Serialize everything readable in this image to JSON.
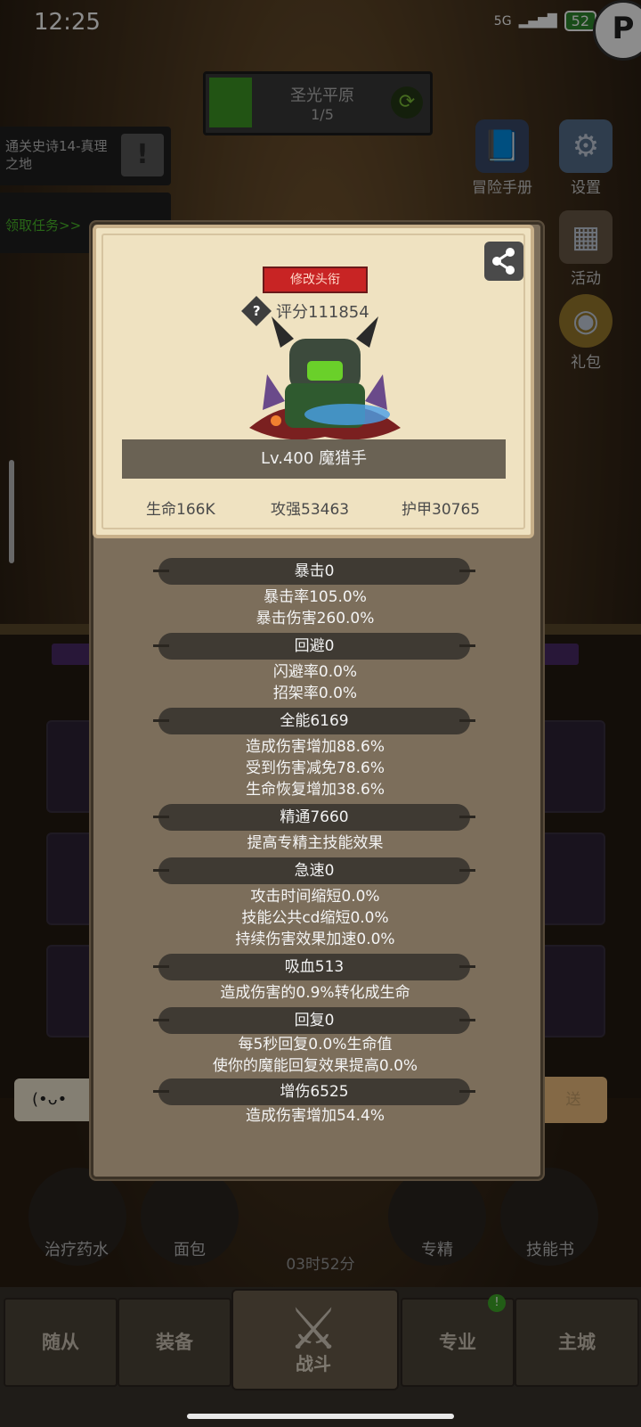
{
  "status_bar": {
    "time": "12:25",
    "network": "5G",
    "battery": "52"
  },
  "map": {
    "name": "圣光平原",
    "progress": "1/5"
  },
  "quests": {
    "epic": "通关史诗14-真理之地",
    "claim": "领取任务>>"
  },
  "side_menu": [
    {
      "label": "冒险手册"
    },
    {
      "label": "设置"
    },
    {
      "label": "活动"
    },
    {
      "label": "礼包"
    }
  ],
  "profile": {
    "change_title_label": "修改头衔",
    "score": "评分111854",
    "level_name": "Lv.400 魔猎手",
    "base_stats": {
      "hp": "生命166K",
      "attack": "攻强53463",
      "armor": "护甲30765"
    }
  },
  "stat_sections": [
    {
      "title": "暴击0",
      "lines": [
        "暴击率105.0%",
        "暴击伤害260.0%"
      ]
    },
    {
      "title": "回避0",
      "lines": [
        "闪避率0.0%",
        "招架率0.0%"
      ]
    },
    {
      "title": "全能6169",
      "lines": [
        "造成伤害增加88.6%",
        "受到伤害减免78.6%",
        "生命恢复增加38.6%"
      ]
    },
    {
      "title": "精通7660",
      "lines": [
        "提高专精主技能效果"
      ]
    },
    {
      "title": "急速0",
      "lines": [
        "攻击时间缩短0.0%",
        "技能公共cd缩短0.0%",
        "持续伤害效果加速0.0%"
      ]
    },
    {
      "title": "吸血513",
      "lines": [
        "造成伤害的0.9%转化成生命"
      ]
    },
    {
      "title": "回复0",
      "lines": [
        "每5秒回复0.0%生命值",
        "使你的魔能回复效果提高0.0%"
      ]
    },
    {
      "title": "增伤6525",
      "lines": [
        "造成伤害增加54.4%"
      ]
    }
  ],
  "chat": {
    "emoji": "(•ᴗ•",
    "send_label": "送"
  },
  "quick_items": [
    {
      "label": "治疗药水"
    },
    {
      "label": "面包"
    },
    {
      "label": "专精"
    },
    {
      "label": "技能书"
    }
  ],
  "chest_timer": "03时52分",
  "nav": {
    "followers": "随从",
    "equipment": "装备",
    "battle": "战斗",
    "profession": "专业",
    "city": "主城",
    "profession_badge": "!"
  }
}
